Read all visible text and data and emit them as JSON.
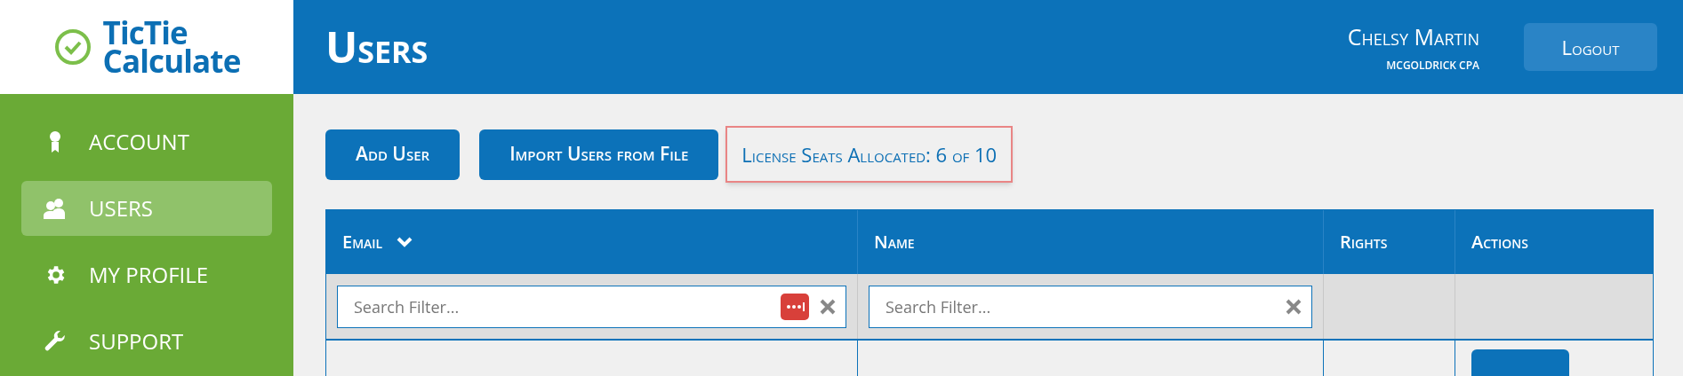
{
  "logo": {
    "line_1": "TicTie",
    "line_2": "Calculate"
  },
  "sidebar": {
    "items": [
      {
        "label": "ACCOUNT",
        "kind": "ribbon",
        "selected": false
      },
      {
        "label": "USERS",
        "kind": "users",
        "selected": true
      },
      {
        "label": "MY PROFILE",
        "kind": "gear",
        "selected": false
      },
      {
        "label": "SUPPORT",
        "kind": "wrench",
        "selected": false
      }
    ]
  },
  "header": {
    "title": "Users",
    "user_name": "Chelsy Martin",
    "company": "MCGOLDRICK CPA",
    "logout": "Logout"
  },
  "toolbar": {
    "buttons": [
      "Add User",
      "Import Users from File"
    ],
    "license_seats": "License Seats Allocated: 6 of 10"
  },
  "table": {
    "columns": [
      {
        "label": "Email",
        "sortable": true
      },
      {
        "label": "Name",
        "sortable": false
      },
      {
        "label": "Rights",
        "sortable": false
      },
      {
        "label": "Actions",
        "sortable": false
      }
    ],
    "filters": [
      {
        "placeholder": "Search Filter...",
        "password_icon": true
      },
      {
        "placeholder": "Search Filter...",
        "password_icon": false
      }
    ],
    "rows": [
      {
        "action_button": true
      }
    ]
  }
}
